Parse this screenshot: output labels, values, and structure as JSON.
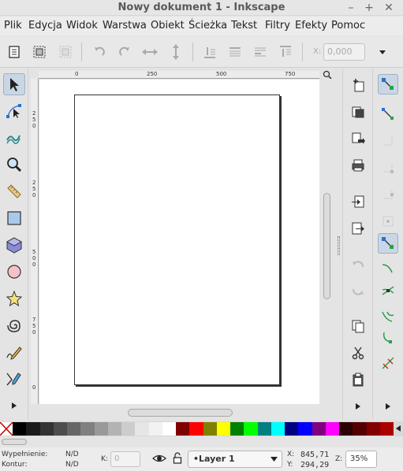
{
  "window": {
    "title": "Nowy dokument 1 - Inkscape",
    "buttons": [
      "–",
      "+",
      "✕"
    ]
  },
  "menu": [
    "Plik",
    "Edycja",
    "Widok",
    "Warstwa",
    "Obiekt",
    "Ścieżka",
    "Tekst",
    "Filtry",
    "Efekty",
    "Pomoc"
  ],
  "controls": {
    "x_label": "X:",
    "x_value": "0,000"
  },
  "rulers": {
    "top": [
      "0",
      "250",
      "500",
      "750"
    ],
    "left": [
      "2",
      "5",
      "0",
      "2",
      "5",
      "0",
      "5",
      "0",
      "0",
      "7",
      "5",
      "0",
      "0"
    ]
  },
  "palette": [
    "#000000",
    "#1a1a1a",
    "#333333",
    "#4d4d4d",
    "#666666",
    "#808080",
    "#999999",
    "#b3b3b3",
    "#cccccc",
    "#e6e6e6",
    "#f2f2f2",
    "#ffffff",
    "#800000",
    "#ff0000",
    "#808000",
    "#ffff00",
    "#008000",
    "#00ff00",
    "#008080",
    "#00ffff",
    "#000080",
    "#0000ff",
    "#800080",
    "#ff00ff",
    "#2b0000",
    "#550000",
    "#800000",
    "#aa0000"
  ],
  "status": {
    "fill_label": "Wypełnienie:",
    "fill_value": "N/D",
    "stroke_label": "Kontur:",
    "stroke_value": "N/D",
    "opacity_label": "K:",
    "opacity_value": "0",
    "layer": "•Layer 1",
    "x_label": "X:",
    "x_value": "845,71",
    "y_label": "Y:",
    "y_value": "294,29",
    "zoom_label": "Z:",
    "zoom_value": "35%"
  }
}
